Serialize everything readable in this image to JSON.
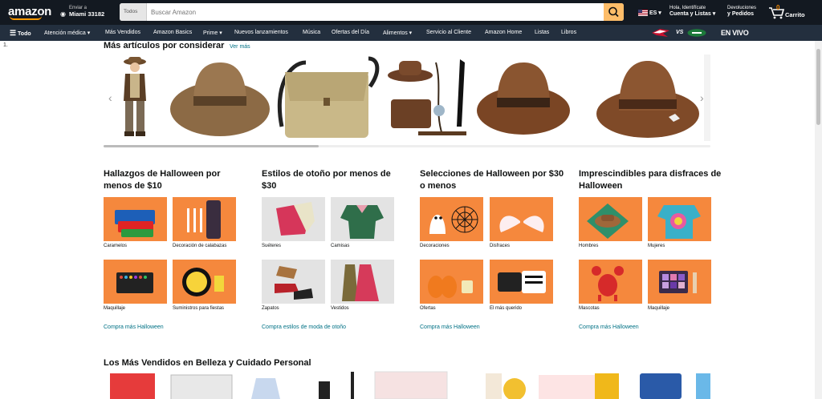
{
  "header": {
    "logo": "amazon",
    "deliver_top": "Enviar a",
    "deliver_location": "Miami 33182",
    "search_category": "Todos",
    "search_placeholder": "Buscar Amazon",
    "language": "ES",
    "account_top": "Hola, Identifícate",
    "account_main": "Cuenta y Listas",
    "orders_top": "Devoluciones",
    "orders_main": "y Pedidos",
    "cart_count": "0",
    "cart_label": "Carrito"
  },
  "subnav": {
    "all_label": "Todo",
    "items": [
      "Atención médica",
      "Más Vendidos",
      "Amazon Basics",
      "Prime",
      "Nuevos lanzamientos",
      "Música",
      "Ofertas del Día",
      "Alimentos",
      "Servicio al Cliente",
      "Amazon Home",
      "Listas",
      "Libros"
    ],
    "promo_label": "EN VIVO",
    "promo_vs": "VS"
  },
  "list_marker": "1.",
  "carousel": {
    "title": "Más artículos por considerar",
    "see_more": "Ver más"
  },
  "cards": [
    {
      "title": "Hallazgos de Halloween por menos de $10",
      "tiles": [
        "Caramelos",
        "Decoración de calabazas",
        "Maquillaje",
        "Suministros para fiestas"
      ],
      "link": "Compra más Halloween"
    },
    {
      "title": "Estilos de otoño por menos de $30",
      "tiles": [
        "Suéteres",
        "Camisas",
        "Zapatos",
        "Vestidos"
      ],
      "link": "Compra estilos de moda de otoño"
    },
    {
      "title": "Selecciones de Halloween por $30 o menos",
      "tiles": [
        "Decoraciones",
        "Disfraces",
        "Ofertas",
        "El más querido"
      ],
      "link": "Compra más Halloween"
    },
    {
      "title": "Imprescindibles para disfraces de Halloween",
      "tiles": [
        "Hombres",
        "Mujeres",
        "Mascotas",
        "Maquillaje"
      ],
      "link": "Compra más Halloween"
    }
  ],
  "bottom": {
    "title": "Los Más Vendidos en Belleza y Cuidado Personal"
  },
  "colors": {
    "nav_dark": "#131921",
    "nav_sub": "#232f3e",
    "accent": "#febd69",
    "orange_tile": "#f5883d",
    "link": "#007185"
  }
}
